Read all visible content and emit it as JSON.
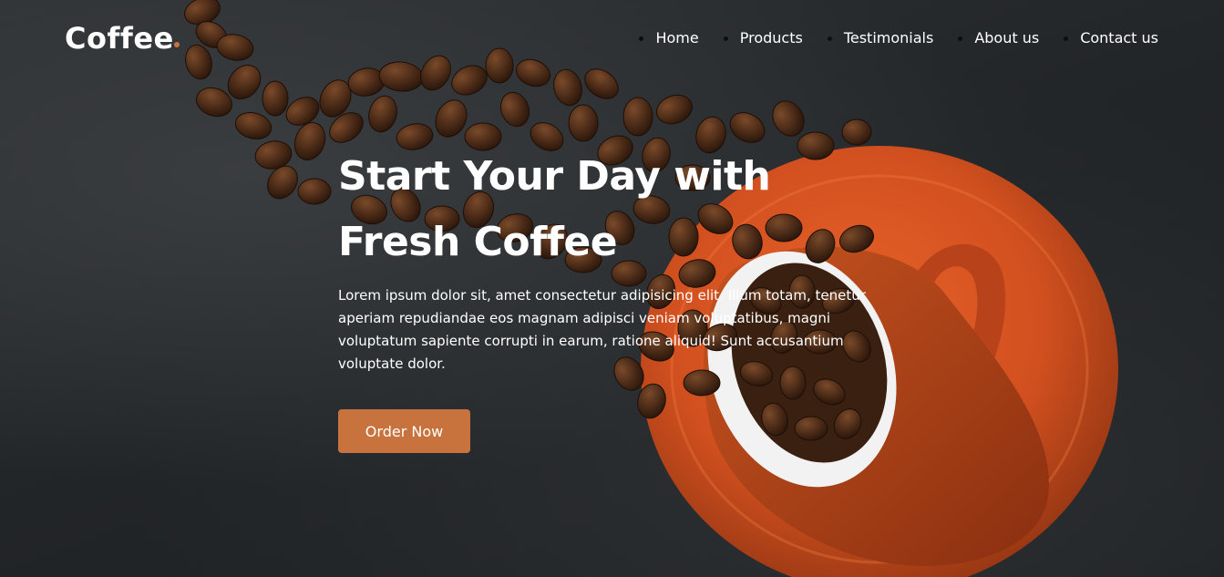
{
  "brand": {
    "name": "Coffee",
    "accent_color": "#c8733e"
  },
  "nav": {
    "items": [
      {
        "label": "Home"
      },
      {
        "label": "Products"
      },
      {
        "label": "Testimonials"
      },
      {
        "label": "About us"
      },
      {
        "label": "Contact us"
      }
    ]
  },
  "hero": {
    "headline_line1": "Start Your Day with",
    "headline_line2": "Fresh Coffee",
    "description": "Lorem ipsum dolor sit, amet consectetur adipisicing elit. Illum totam, tenetur aperiam repudiandae eos magnam adipisci veniam voluptatibus, magni voluptatum sapiente corrupti in earum, ratione aliquid! Sunt accusantium voluptate dolor.",
    "cta_label": "Order Now",
    "background_color": "#24272a",
    "saucer_color": "#d2501f",
    "cup_color": "#b8431a",
    "bean_color": "#4a2a17"
  }
}
